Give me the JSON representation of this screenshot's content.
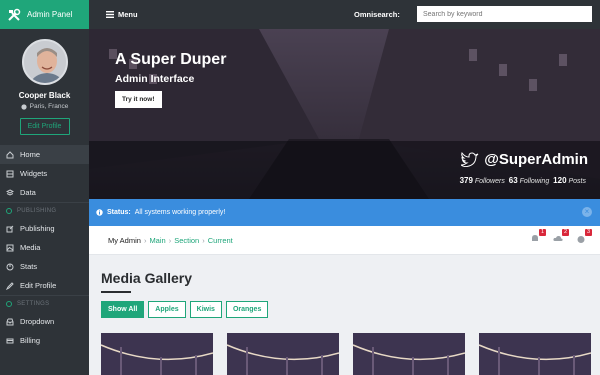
{
  "brand": {
    "title": "Admin Panel"
  },
  "profile": {
    "name": "Cooper Black",
    "location": "Paris, France",
    "edit_label": "Edit Profile"
  },
  "sidebar": {
    "items": [
      {
        "label": "Home",
        "icon": "home-icon",
        "active": true
      },
      {
        "label": "Widgets",
        "icon": "widgets-icon"
      },
      {
        "label": "Data",
        "icon": "data-icon"
      }
    ],
    "section_publishing": "PUBLISHING",
    "publishing_items": [
      {
        "label": "Publishing",
        "icon": "edit-icon"
      },
      {
        "label": "Media",
        "icon": "image-icon"
      },
      {
        "label": "Stats",
        "icon": "stats-icon"
      },
      {
        "label": "Edit Profile",
        "icon": "pencil-icon"
      }
    ],
    "section_settings": "SETTINGS",
    "settings_items": [
      {
        "label": "Dropdown",
        "icon": "inbox-icon"
      },
      {
        "label": "Billing",
        "icon": "billing-icon"
      }
    ]
  },
  "topbar": {
    "menu_label": "Menu",
    "omnisearch_label": "Omnisearch:",
    "search_placeholder": "Search by keyword"
  },
  "hero": {
    "title": "A Super Duper",
    "subtitle": "Admin Interface",
    "button_label": "Try it now!",
    "twitter_handle": "@SuperAdmin",
    "followers_count": "379",
    "followers_label": "Followers",
    "following_count": "63",
    "following_label": "Following",
    "posts_count": "120",
    "posts_label": "Posts"
  },
  "alert": {
    "title": "Status:",
    "message": "All systems working properly!"
  },
  "breadcrumb": {
    "root": "My Admin",
    "items": [
      "Main",
      "Section",
      "Current"
    ]
  },
  "notifications": [
    {
      "icon": "bell-icon",
      "count": "1"
    },
    {
      "icon": "cloud-icon",
      "count": "2"
    },
    {
      "icon": "globe-icon",
      "count": "3"
    }
  ],
  "gallery": {
    "title": "Media Gallery",
    "filters": [
      "Show All",
      "Apples",
      "Kiwis",
      "Oranges"
    ]
  },
  "colors": {
    "accent": "#1fa67a",
    "sidebar": "#2e3338",
    "alert": "#3a8dde",
    "badge": "#d9283b"
  }
}
